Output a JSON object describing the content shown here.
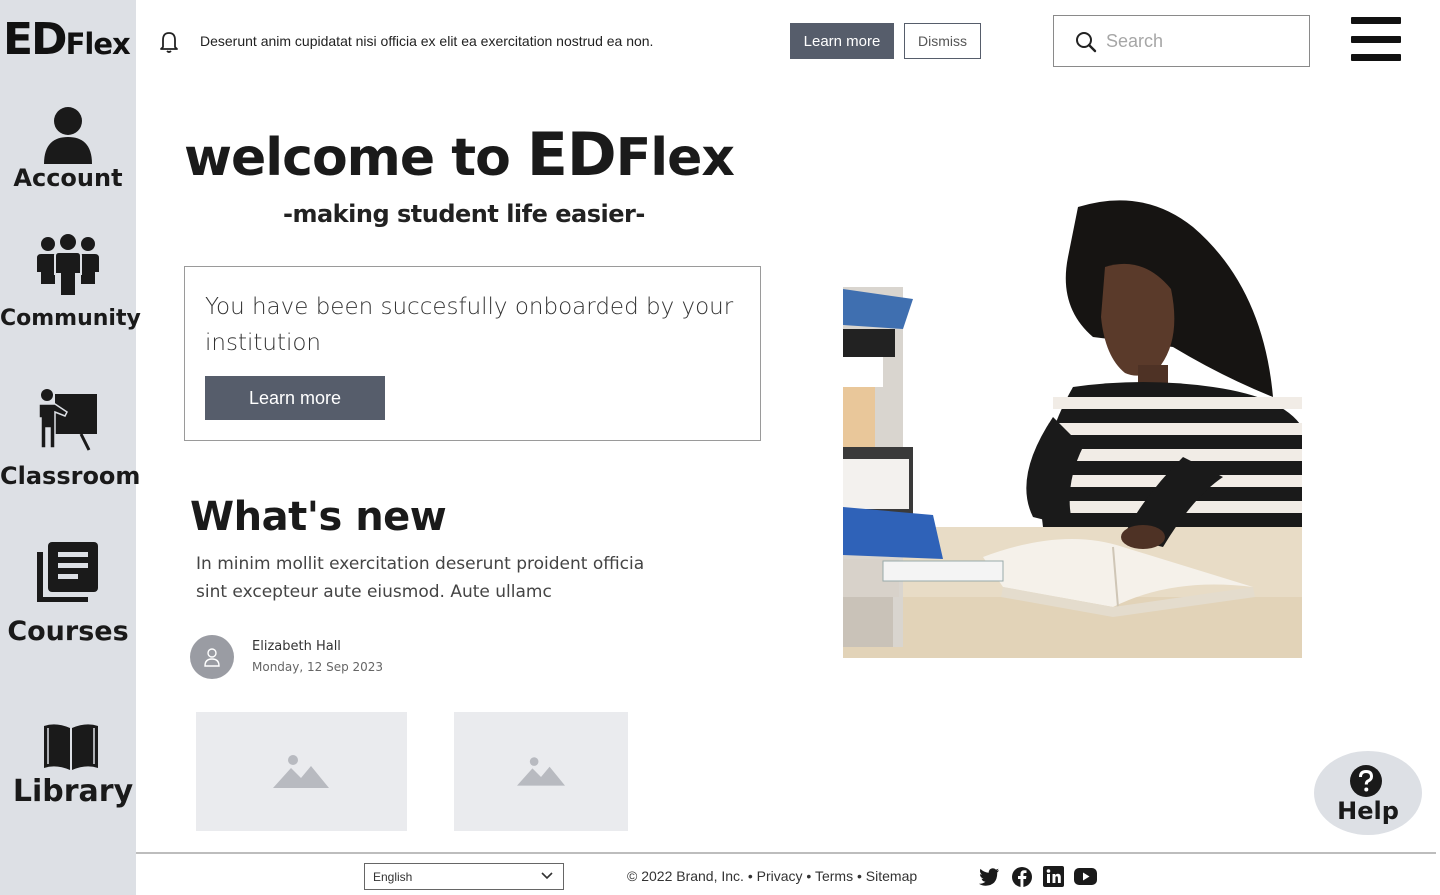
{
  "brand": {
    "logo_primary": "ED",
    "logo_secondary": "Flex"
  },
  "sidebar": {
    "items": [
      {
        "label": "Account",
        "icon": "account-icon"
      },
      {
        "label": "Community",
        "icon": "community-icon"
      },
      {
        "label": "Classroom",
        "icon": "classroom-icon"
      },
      {
        "label": "Courses",
        "icon": "courses-icon"
      },
      {
        "label": "Library",
        "icon": "library-icon"
      }
    ]
  },
  "header": {
    "banner_text": "Deserunt anim cupidatat nisi officia ex elit ea exercitation nostrud ea non.",
    "learn_more_label": "Learn more",
    "dismiss_label": "Dismiss",
    "search_placeholder": "Search",
    "search_value": ""
  },
  "hero": {
    "title_prefix": "welcome to ",
    "title_brand_primary": "ED",
    "title_brand_secondary": "Flex",
    "subtitle": "-making student life easier-"
  },
  "onboarding": {
    "message": "You have been succesfully onboarded by your institution",
    "button_label": "Learn more"
  },
  "whats_new": {
    "title": "What's new",
    "body": "In minim mollit exercitation deserunt proident officia sint excepteur aute eiusmod. Aute ullamc",
    "author_name": "Elizabeth Hall",
    "author_date": "Monday, 12 Sep 2023"
  },
  "help": {
    "label": "Help"
  },
  "footer": {
    "language": "English",
    "copyright": "© 2022 Brand, Inc.",
    "separator": " • ",
    "links": [
      "Privacy",
      "Terms",
      "Sitemap"
    ],
    "socials": [
      "twitter-icon",
      "facebook-icon",
      "linkedin-icon",
      "youtube-icon"
    ]
  },
  "colors": {
    "sidebar_bg": "#dde0e5",
    "primary_button": "#565d6b",
    "placeholder_bg": "#eaebee"
  }
}
